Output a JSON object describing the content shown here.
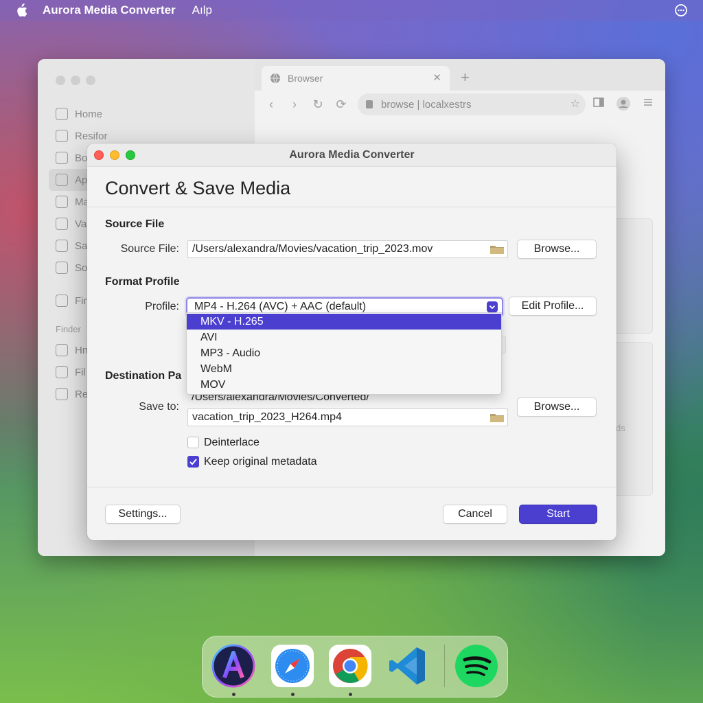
{
  "menubar": {
    "app_name": "Aurora Media Converter",
    "menu_item": "Aılp"
  },
  "background_window": {
    "sidebar_items": [
      "Home",
      "Resifor",
      "Bo",
      "Ap",
      "Ma",
      "Va",
      "Sa",
      "So",
      "Fin"
    ],
    "sidebar_section": "Finder",
    "sidebar_items_2": [
      "Hn",
      "Fil",
      "Re"
    ],
    "tab_title": "Browser",
    "url": "browse | localxestrs",
    "faint_label": "ds"
  },
  "dialog": {
    "window_title": "Aurora Media Converter",
    "heading": "Convert & Save Media",
    "source": {
      "section_title": "Source File",
      "label": "Source File:",
      "value": "/Users/alexandra/Movies/vacation_trip_2023.mov",
      "browse_label": "Browse..."
    },
    "format": {
      "section_title": "Format Profile",
      "label": "Profile:",
      "selected": "MP4 - H.264 (AVC) + AAC (default)",
      "edit_label": "Edit Profile...",
      "options": [
        "MKV - H.265",
        "AVI",
        "MP3 - Audio",
        "WebM",
        "MOV"
      ],
      "highlighted_index": 0
    },
    "destination": {
      "section_title": "Destination Pa",
      "label": "Save to:",
      "folder": "/Users/alexandra/Movies/Converted/",
      "filename": "vacation_trip_2023_H264.mp4",
      "browse_label": "Browse..."
    },
    "options": {
      "deinterlace_label": "Deinterlace",
      "deinterlace_checked": false,
      "metadata_label": "Keep original metadata",
      "metadata_checked": true
    },
    "footer": {
      "settings_label": "Settings...",
      "cancel_label": "Cancel",
      "start_label": "Start"
    }
  },
  "dock": {
    "apps": [
      "aurora-app-icon",
      "safari-icon",
      "chrome-icon",
      "vscode-icon",
      "spotify-icon"
    ]
  },
  "colors": {
    "accent": "#4b3fd0"
  }
}
